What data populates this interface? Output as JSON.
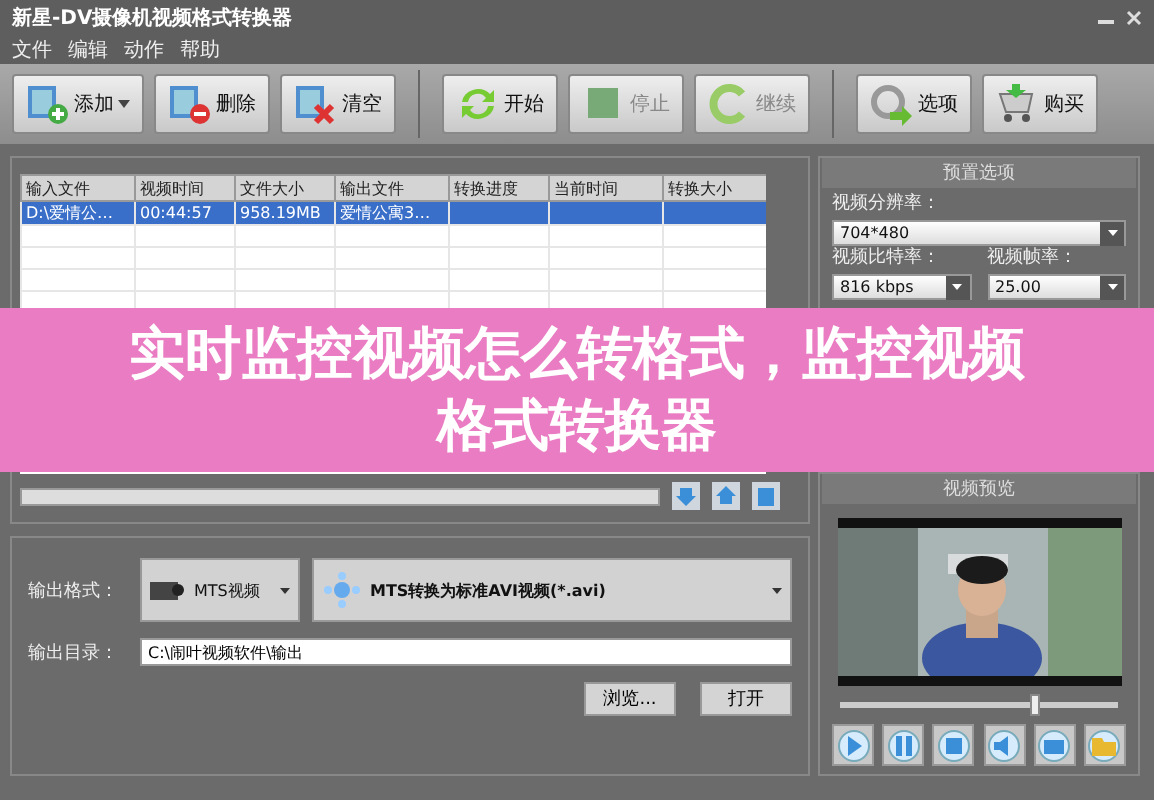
{
  "window": {
    "title": "新星-DV摄像机视频格式转换器"
  },
  "menu": [
    "文件",
    "编辑",
    "动作",
    "帮助"
  ],
  "toolbar": [
    {
      "label": "添加",
      "kind": "add",
      "dropdown": true,
      "disabled": false
    },
    {
      "label": "删除",
      "kind": "remove",
      "dropdown": false,
      "disabled": false
    },
    {
      "label": "清空",
      "kind": "clear",
      "dropdown": false,
      "disabled": false
    },
    {
      "label": "开始",
      "kind": "start",
      "dropdown": false,
      "disabled": false
    },
    {
      "label": "停止",
      "kind": "stop",
      "dropdown": false,
      "disabled": true
    },
    {
      "label": "继续",
      "kind": "resume",
      "dropdown": false,
      "disabled": true
    },
    {
      "label": "选项",
      "kind": "options",
      "dropdown": false,
      "disabled": false
    },
    {
      "label": "购买",
      "kind": "buy",
      "dropdown": false,
      "disabled": false
    }
  ],
  "table": {
    "columns": [
      "输入文件",
      "视频时间",
      "文件大小",
      "输出文件",
      "转换进度",
      "当前时间",
      "转换大小"
    ],
    "rows": [
      {
        "cells": [
          "D:\\爱情公…",
          "00:44:57",
          "958.19MB",
          "爱情公寓3…",
          "",
          "",
          ""
        ],
        "selected": true
      }
    ]
  },
  "output": {
    "format_label": "输出格式：",
    "device": "MTS视频",
    "format": "MTS转换为标准AVI视频(*.avi)",
    "dir_label": "输出目录：",
    "dir": "C:\\闹叶视频软件\\输出",
    "buttons": [
      "浏览...",
      "打开"
    ]
  },
  "presets": {
    "title": "预置选项",
    "fields": [
      {
        "label": "视频分辨率：",
        "value": "704*480",
        "wide": true
      },
      {
        "label": "视频比特率：",
        "value": "816 kbps",
        "wide": false
      },
      {
        "label": "视频帧率：",
        "value": "25.00",
        "wide": false
      }
    ]
  },
  "preview": {
    "title": "视频预览",
    "seek": {
      "level": 0.68
    },
    "controls": [
      {
        "kind": "play"
      },
      {
        "kind": "pause"
      },
      {
        "kind": "stop"
      },
      {
        "kind": "volume"
      },
      {
        "kind": "snapshot"
      },
      {
        "kind": "folder"
      }
    ]
  },
  "banner": {
    "text": "实时监控视频怎么转格式，监控视频格式转换器"
  }
}
